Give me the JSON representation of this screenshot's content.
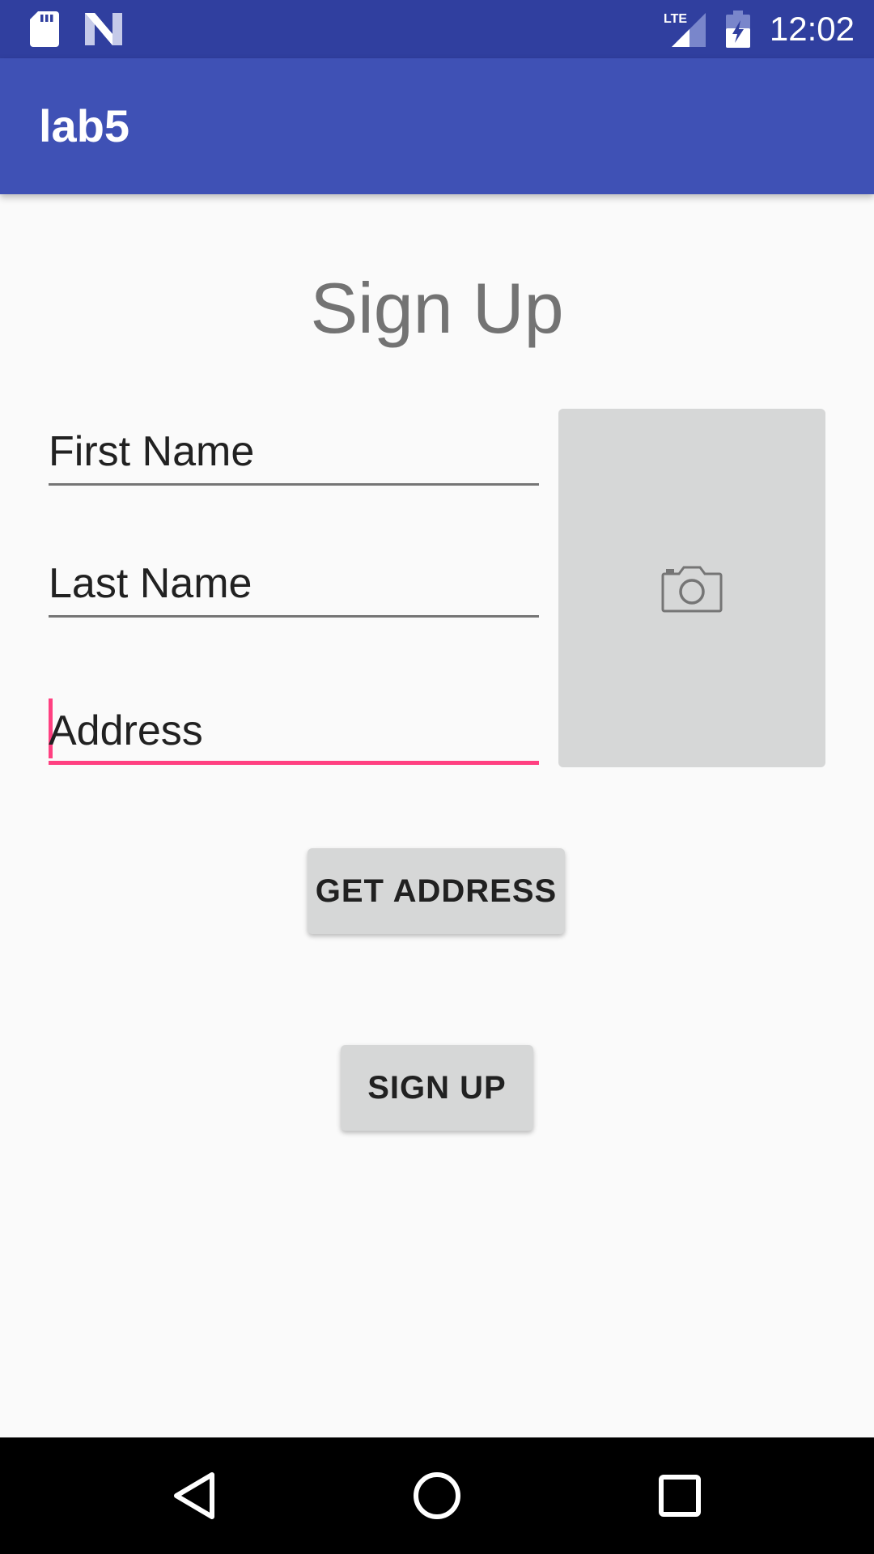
{
  "status_bar": {
    "time": "12:02",
    "icons": [
      "sd-card-icon",
      "notification-n-icon",
      "lte-signal-icon",
      "battery-charging-icon"
    ],
    "network_label": "LTE",
    "background": "#303f9f"
  },
  "app_bar": {
    "title": "lab5",
    "background": "#3f51b5"
  },
  "form": {
    "heading": "Sign Up",
    "first_name_placeholder": "First Name",
    "last_name_placeholder": "Last Name",
    "address_placeholder": "Address",
    "focused_field": "address",
    "accent_color": "#ff4081",
    "photo_icon": "camera-icon",
    "get_address_label": "GET ADDRESS",
    "sign_up_label": "SIGN UP"
  },
  "nav_bar": {
    "icons": [
      "back-icon",
      "home-icon",
      "recents-icon"
    ]
  }
}
